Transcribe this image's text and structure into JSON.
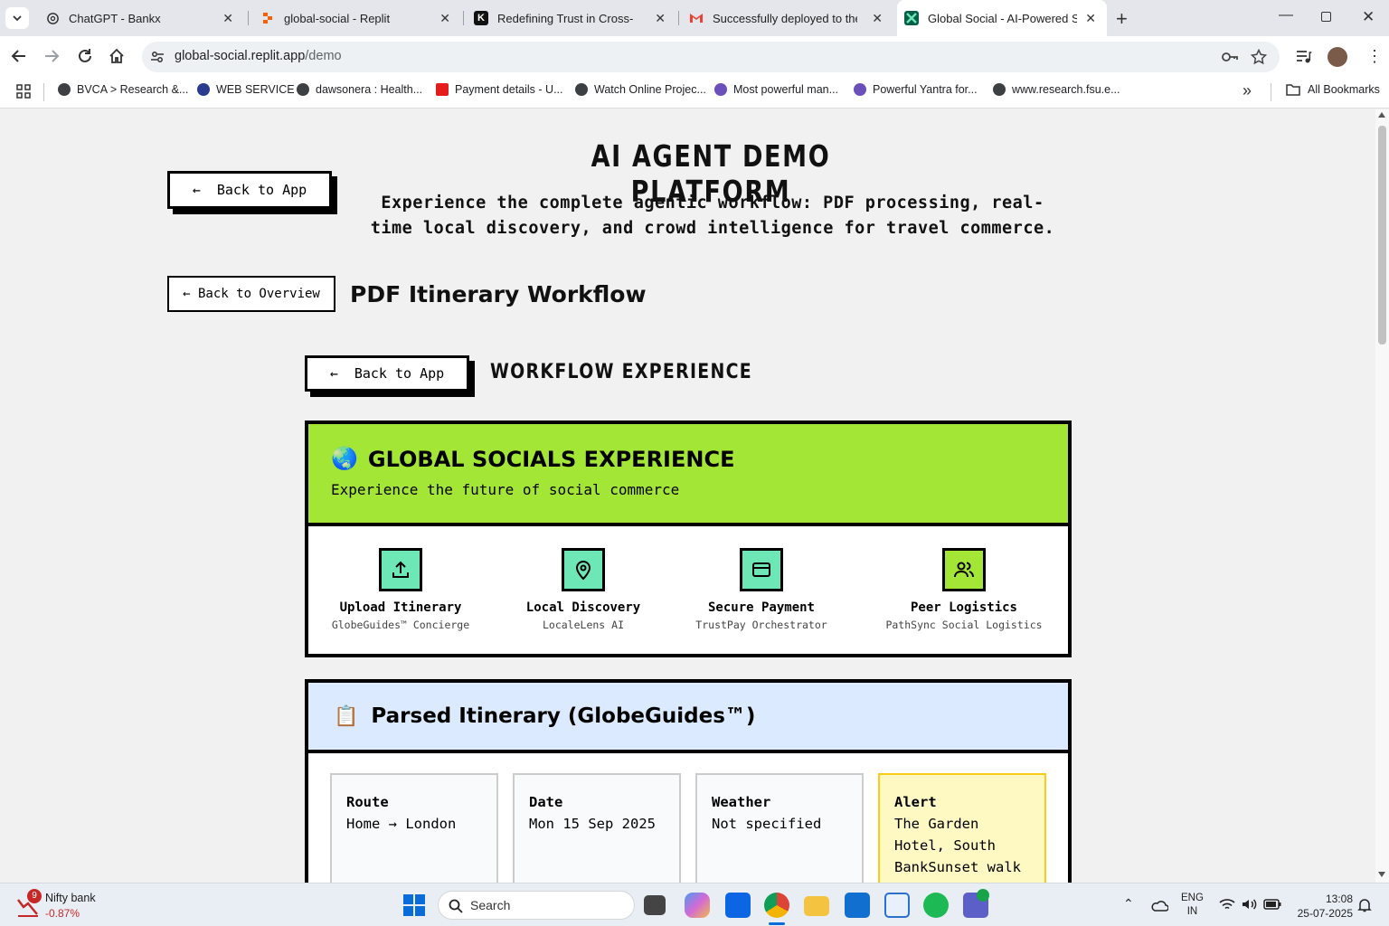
{
  "browser": {
    "tabs": [
      {
        "title": "ChatGPT - Bankx",
        "icon": "chatgpt-icon"
      },
      {
        "title": "global-social - Replit",
        "icon": "replit-icon"
      },
      {
        "title": "Redefining Trust in Cross-Borde",
        "icon": "k-icon"
      },
      {
        "title": "Successfully deployed to the fo",
        "icon": "gmail-icon"
      },
      {
        "title": "Global Social - AI-Powered Soc",
        "icon": "global-social-icon",
        "active": true
      }
    ],
    "url_host": "global-social.replit.app",
    "url_path": "/demo",
    "bookmarks": [
      "BVCA > Research &...",
      "WEB SERVICE",
      "dawsonera : Health...",
      "Payment details - U...",
      "Watch Online Projec...",
      "Most powerful man...",
      "Powerful Yantra for...",
      "www.research.fsu.e..."
    ],
    "all_bookmarks": "All Bookmarks"
  },
  "page": {
    "title": "AI AGENT DEMO PLATFORM",
    "subtitle_line1": "Experience the complete agentic workflow: PDF processing, real-",
    "subtitle_line2": "time local discovery, and crowd intelligence for travel commerce.",
    "back_to_app_1": "Back to App",
    "back_to_overview": "← Back to Overview",
    "section_title": "PDF Itinerary Workflow",
    "back_to_app_2": "Back to App",
    "workflow_title": "WORKFLOW EXPERIENCE",
    "hero": {
      "emoji": "🌏",
      "title": "GLOBAL SOCIALS EXPERIENCE",
      "tagline": "Experience the future of social commerce",
      "color": "#a3e635"
    },
    "features": [
      {
        "title": "Upload Itinerary",
        "sub": "GlobeGuides™ Concierge",
        "icon": "upload-icon",
        "color": "#6ee7b7"
      },
      {
        "title": "Local Discovery",
        "sub": "LocaleLens AI",
        "icon": "map-pin-icon",
        "color": "#6ee7b7"
      },
      {
        "title": "Secure Payment",
        "sub": "TrustPay Orchestrator",
        "icon": "credit-card-icon",
        "color": "#6ee7b7"
      },
      {
        "title": "Peer Logistics",
        "sub": "PathSync Social Logistics",
        "icon": "users-icon",
        "color": "#a3e635"
      }
    ],
    "parsed": {
      "emoji": "📋",
      "title": "Parsed Itinerary (GlobeGuides™)",
      "cards": [
        {
          "label": "Route",
          "value": "Home → London"
        },
        {
          "label": "Date",
          "value": "Mon 15 Sep 2025"
        },
        {
          "label": "Weather",
          "value": "Not specified"
        },
        {
          "label": "Alert",
          "value": "The Garden Hotel, South BankSunset walk along Thames"
        }
      ]
    }
  },
  "taskbar": {
    "stock_name": "Nifty bank",
    "stock_change": "-0.87%",
    "stock_badge": "9",
    "search_placeholder": "Search",
    "lang_line1": "ENG",
    "lang_line2": "IN",
    "time": "13:08",
    "date": "25-07-2025"
  }
}
